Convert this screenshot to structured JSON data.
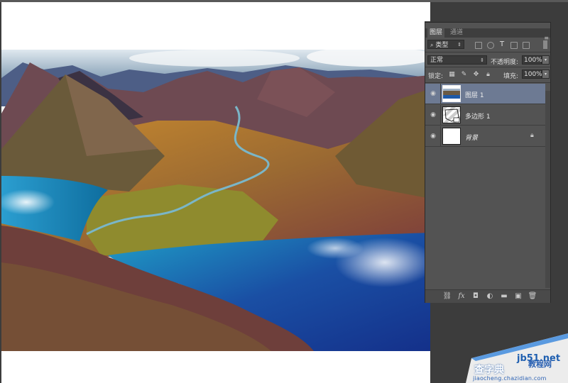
{
  "panel": {
    "tabs": [
      "图层",
      "通道"
    ],
    "filter_kind": "类型",
    "blend_mode": "正常",
    "opacity_label": "不透明度:",
    "opacity_value": "100%",
    "lock_label": "锁定:",
    "fill_label": "填充:",
    "fill_value": "100%",
    "collapse_glyph": "«",
    "menu_glyph": "≡"
  },
  "layers": [
    {
      "name": "图层 1",
      "selected": true
    },
    {
      "name": "多边形 1",
      "selected": false
    },
    {
      "name": "背景",
      "selected": false,
      "locked": true
    }
  ],
  "watermark": {
    "site": "jb51.net",
    "brand": "查字典",
    "brand2": "教程网",
    "url": "jiaocheng.chazidian.com"
  },
  "colors": {
    "ui_dark": "#3c3c3c",
    "panel": "#535353",
    "selection": "#6d7a93"
  }
}
